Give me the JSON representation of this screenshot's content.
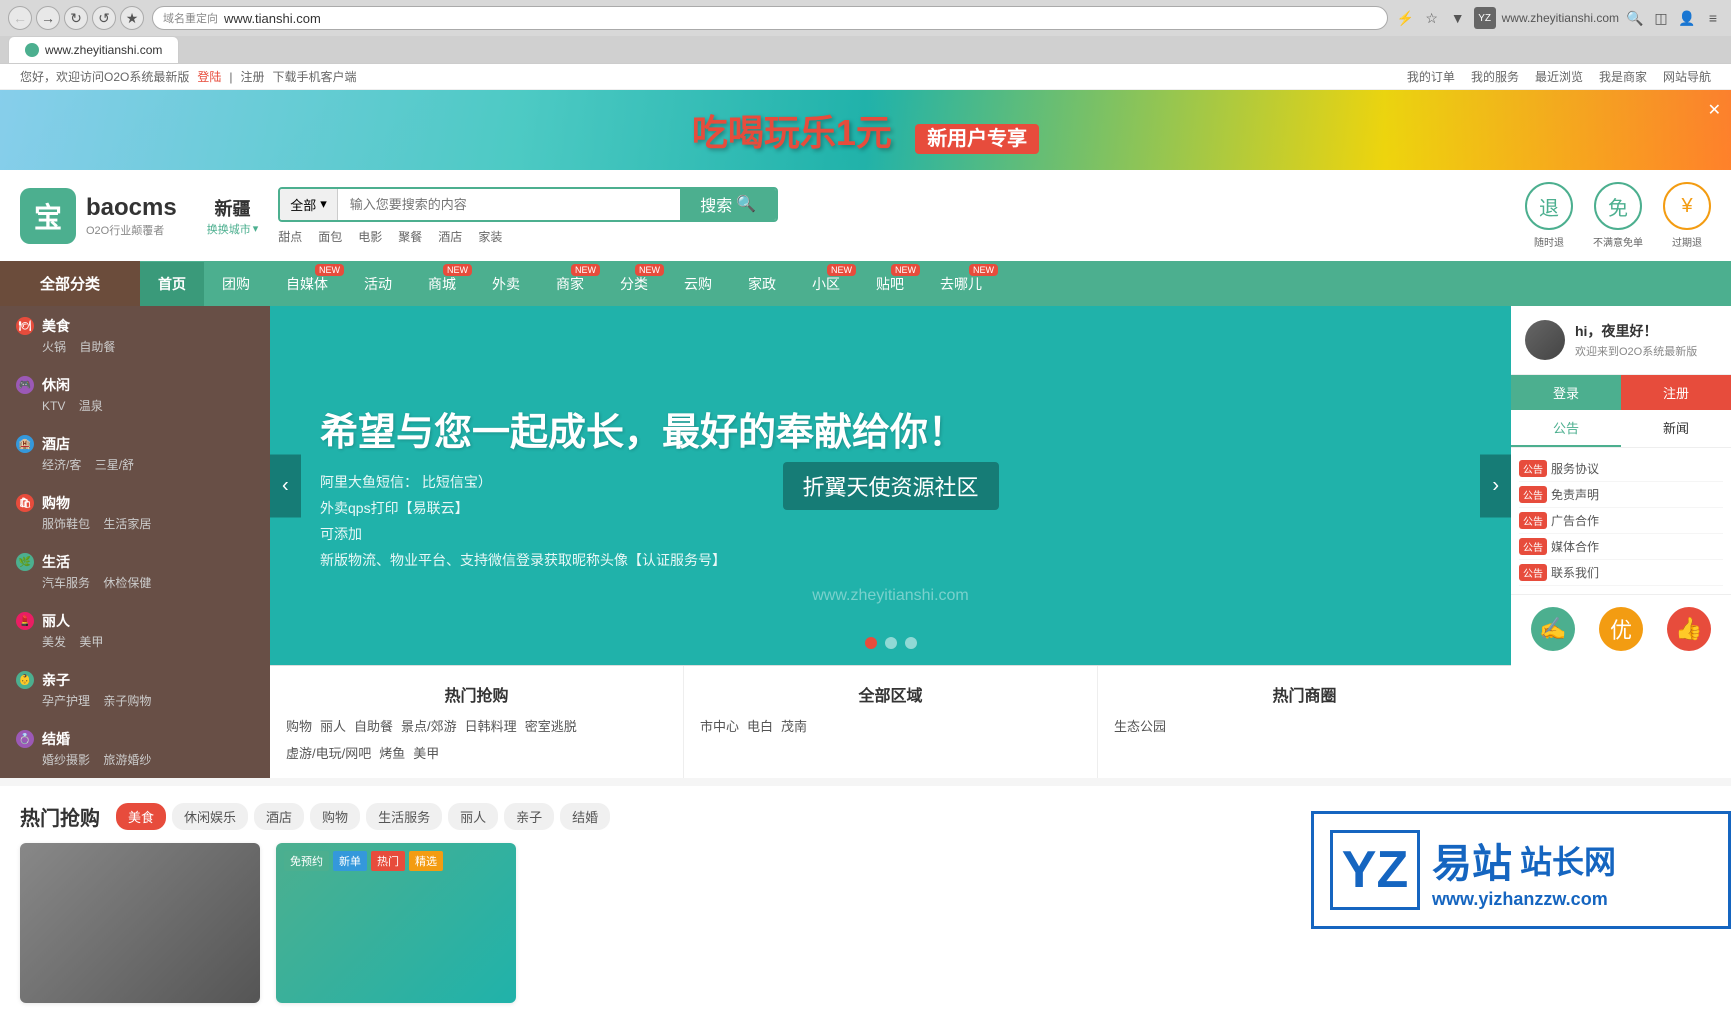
{
  "browser": {
    "url": "www.tianshi.com",
    "url_right": "www.zheyitianshi.com",
    "redirect_label": "域名重定向",
    "tab_label": "www.zheyitianshi.com"
  },
  "topbar": {
    "greeting": "您好，欢迎访问O2O系统最新版",
    "login": "登陆",
    "separator1": "|",
    "register": "注册",
    "download": "下载手机客户端",
    "my_order": "我的订单",
    "my_service": "我的服务",
    "recent_browse": "最近浏览",
    "i_am_merchant": "我是商家",
    "site_nav": "网站导航"
  },
  "header": {
    "logo_char": "宝",
    "brand": "baocms",
    "slogan": "O2O行业颠覆者",
    "city": "新疆",
    "change_city": "换换城市",
    "search_category": "全部",
    "search_placeholder": "输入您要搜索的内容",
    "search_btn": "搜索",
    "search_tags": [
      "甜点",
      "面包",
      "电影",
      "聚餐",
      "酒店",
      "家装"
    ],
    "icon1_label": "随时退",
    "icon2_label": "不满意免单",
    "icon3_label": "过期退"
  },
  "nav": {
    "category": "全部分类",
    "items": [
      {
        "label": "首页",
        "active": true,
        "badge": null
      },
      {
        "label": "团购",
        "active": false,
        "badge": null
      },
      {
        "label": "自媒体",
        "active": false,
        "badge": "NEW"
      },
      {
        "label": "活动",
        "active": false,
        "badge": null
      },
      {
        "label": "商城",
        "active": false,
        "badge": "NEW"
      },
      {
        "label": "外卖",
        "active": false,
        "badge": null
      },
      {
        "label": "商家",
        "active": false,
        "badge": "NEW"
      },
      {
        "label": "分类",
        "active": false,
        "badge": "NEW"
      },
      {
        "label": "云购",
        "active": false,
        "badge": null
      },
      {
        "label": "家政",
        "active": false,
        "badge": null
      },
      {
        "label": "小区",
        "active": false,
        "badge": "NEW"
      },
      {
        "label": "贴吧",
        "active": false,
        "badge": "NEW"
      },
      {
        "label": "去哪儿",
        "active": false,
        "badge": "NEW"
      }
    ]
  },
  "sidebar": {
    "items": [
      {
        "icon": "🍽",
        "color": "#e74c3c",
        "label": "美食",
        "subs": [
          "火锅",
          "自助餐"
        ]
      },
      {
        "icon": "🎮",
        "color": "#9b59b6",
        "label": "休闲",
        "subs": [
          "KTV",
          "温泉"
        ]
      },
      {
        "icon": "🏨",
        "color": "#3498db",
        "label": "酒店",
        "subs": [
          "经济/客",
          "三星/舒"
        ]
      },
      {
        "icon": "🛍",
        "color": "#e74c3c",
        "label": "购物",
        "subs": [
          "服饰鞋包",
          "生活家居"
        ]
      },
      {
        "icon": "🌿",
        "color": "#4caf8f",
        "label": "生活",
        "subs": [
          "汽车服务",
          "休检保健"
        ]
      },
      {
        "icon": "💄",
        "color": "#e91e63",
        "label": "丽人",
        "subs": [
          "美发",
          "美甲"
        ]
      },
      {
        "icon": "👶",
        "color": "#4caf8f",
        "label": "亲子",
        "subs": [
          "孕产护理",
          "亲子购物"
        ]
      },
      {
        "icon": "💍",
        "color": "#9b59b6",
        "label": "结婚",
        "subs": [
          "婚纱摄影",
          "旅游婚纱"
        ]
      }
    ]
  },
  "carousel": {
    "main_text": "希望与您一起成长，最好的奉献给你！",
    "overlay": "折翼天使资源社区",
    "watermark": "www.zheyitianshi.com",
    "items": [
      "阿里大鱼短信：                              比短信宝）",
      "外卖qps打印【易联云】",
      "可添加                   ",
      "新版物流、物业平台、支持微信登录获取昵称头像【认证服务号】"
    ],
    "dots": 3,
    "active_dot": 0
  },
  "user_panel": {
    "hello": "hi，夜里好！",
    "welcome": "欢迎来到O2O系统最新版",
    "login_btn": "登录",
    "register_btn": "注册",
    "tabs": [
      "公告",
      "新闻"
    ],
    "notices": [
      {
        "prefix": "【公告】",
        "text": "服务协议"
      },
      {
        "prefix": "【公告】",
        "text": "免责声明"
      },
      {
        "prefix": "【公告】",
        "text": "广告合作"
      },
      {
        "prefix": "【公告】",
        "text": "媒体合作"
      },
      {
        "prefix": "【公告】",
        "text": "联系我们"
      }
    ]
  },
  "hot_sections": {
    "section1_title": "热门抢购",
    "section1_tags": [
      "购物",
      "丽人",
      "自助餐",
      "景点/郊游",
      "日韩料理",
      "密室逃脱",
      "虚游/电玩/网吧",
      "烤鱼",
      "美甲"
    ],
    "section2_title": "全部区域",
    "section2_tags": [
      "市中心",
      "电白",
      "茂南"
    ],
    "section3_title": "热门商圈",
    "section3_tags": [
      "生态公园"
    ]
  },
  "hot_purchase": {
    "title": "热门抢购",
    "tabs": [
      "美食",
      "休闲娱乐",
      "酒店",
      "购物",
      "生活服务",
      "丽人",
      "亲子",
      "结婚"
    ],
    "active_tab": "美食"
  },
  "bottom_ad": {
    "yz_text": "YZ",
    "site_text": "易站",
    "site_long": "站长网",
    "url": "www.yizhanzzw.com"
  }
}
